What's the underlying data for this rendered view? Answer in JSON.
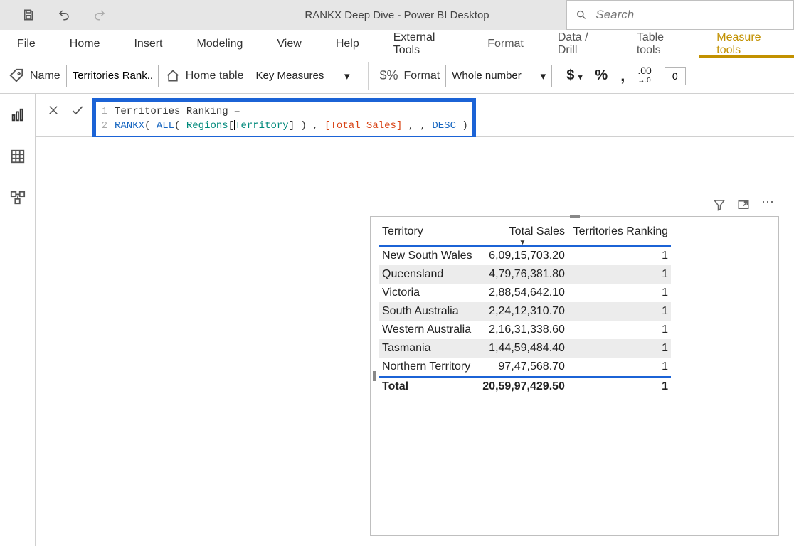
{
  "titlebar": {
    "app_title": "RANKX Deep Dive - Power BI Desktop",
    "search_placeholder": "Search"
  },
  "tabs": {
    "file": "File",
    "home": "Home",
    "insert": "Insert",
    "modeling": "Modeling",
    "view": "View",
    "help": "Help",
    "external_tools": "External Tools",
    "format": "Format",
    "data_drill": "Data / Drill",
    "table_tools": "Table tools",
    "measure_tools": "Measure tools"
  },
  "subribbon": {
    "name_label": "Name",
    "name_value": "Territories Rank...",
    "home_table_label": "Home table",
    "home_table_value": "Key Measures",
    "format_label": "Format",
    "format_value": "Whole number",
    "decimals_value": "0"
  },
  "formula": {
    "line1_prefix": "Territories Ranking =",
    "rankx": "RANKX",
    "all": "ALL",
    "col_left": "Regions",
    "col_right": "Territory",
    "measure": "[Total Sales]",
    "desc": "DESC"
  },
  "table_visual": {
    "columns": [
      "Territory",
      "Total Sales",
      "Territories Ranking"
    ],
    "rows": [
      {
        "territory": "New South Wales",
        "total_sales": "6,09,15,703.20",
        "rank": "1"
      },
      {
        "territory": "Queensland",
        "total_sales": "4,79,76,381.80",
        "rank": "1"
      },
      {
        "territory": "Victoria",
        "total_sales": "2,88,54,642.10",
        "rank": "1"
      },
      {
        "territory": "South Australia",
        "total_sales": "2,24,12,310.70",
        "rank": "1"
      },
      {
        "territory": "Western Australia",
        "total_sales": "2,16,31,338.60",
        "rank": "1"
      },
      {
        "territory": "Tasmania",
        "total_sales": "1,44,59,484.40",
        "rank": "1"
      },
      {
        "territory": "Northern Territory",
        "total_sales": "97,47,568.70",
        "rank": "1"
      }
    ],
    "total_label": "Total",
    "total_sales": "20,59,97,429.50",
    "total_rank": "1"
  }
}
